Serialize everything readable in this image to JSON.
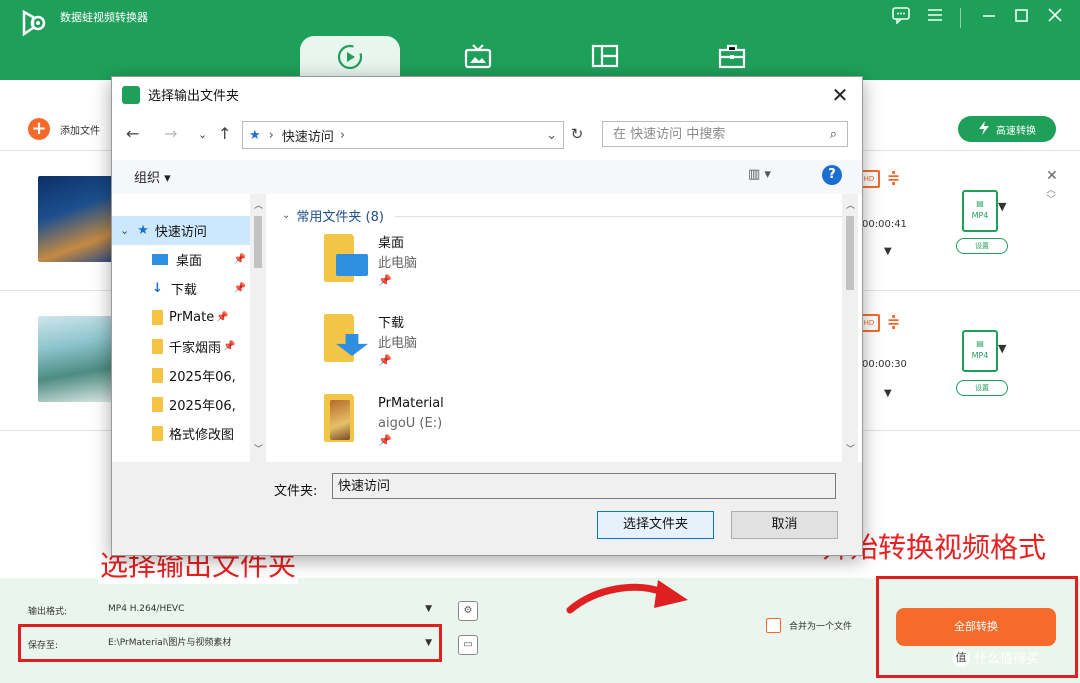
{
  "app": {
    "title": "数据蛙视频转换器",
    "accent_color": "#1fa05a",
    "window_controls": [
      "chat-icon",
      "menu-icon",
      "minimize-icon",
      "maximize-icon",
      "close-icon"
    ],
    "nav_tabs": [
      {
        "icon": "convert-icon",
        "active": true
      },
      {
        "icon": "tv-icon",
        "active": false
      },
      {
        "icon": "layout-icon",
        "active": false
      },
      {
        "icon": "toolbox-icon",
        "active": false
      }
    ],
    "add_file_label": "添加文件",
    "high_speed_label": "高速转换",
    "files": [
      {
        "duration": "00:00:41",
        "format": "MP4",
        "settings_label": "设置"
      },
      {
        "duration": "00:00:30",
        "format": "MP4",
        "settings_label": "设置"
      }
    ],
    "bottom": {
      "output_format_label": "输出格式:",
      "output_format_value": "MP4 H.264/HEVC",
      "save_to_label": "保存至:",
      "save_to_value": "E:\\PrMaterial\\图片与视频素材",
      "merge_label": "合并为一个文件",
      "convert_all_label": "全部转换"
    }
  },
  "dialog": {
    "title": "选择输出文件夹",
    "address": "快速访问",
    "search_placeholder": "在 快速访问 中搜索",
    "organize_label": "组织 ▾",
    "help_label": "?",
    "nav_pane": [
      {
        "label": "快速访问",
        "type": "star"
      },
      {
        "label": "桌面",
        "type": "desktop",
        "pinned": true
      },
      {
        "label": "下载",
        "type": "download",
        "pinned": true
      },
      {
        "label": "PrMate",
        "type": "folder",
        "pinned": true
      },
      {
        "label": "千家烟雨",
        "type": "folder",
        "pinned": true
      },
      {
        "label": "2025年06,",
        "type": "folder"
      },
      {
        "label": "2025年06,",
        "type": "folder"
      },
      {
        "label": "格式修改图",
        "type": "folder"
      }
    ],
    "group_header": "常用文件夹 (8)",
    "quick_items": [
      {
        "name": "桌面",
        "sub": "此电脑",
        "icon": "desktop-folder-icon"
      },
      {
        "name": "下载",
        "sub": "此电脑",
        "icon": "download-folder-icon"
      },
      {
        "name": "PrMaterial",
        "sub": "aigoU (E:)",
        "icon": "prmaterial-folder-icon"
      }
    ],
    "folder_label": "文件夹:",
    "folder_value": "快速访问",
    "select_button": "选择文件夹",
    "cancel_button": "取消"
  },
  "annotations": {
    "select_output_folder": "选择输出文件夹",
    "start_converting": "开始转换视频格式",
    "color": "#e02020"
  },
  "watermark": "什么值得买"
}
